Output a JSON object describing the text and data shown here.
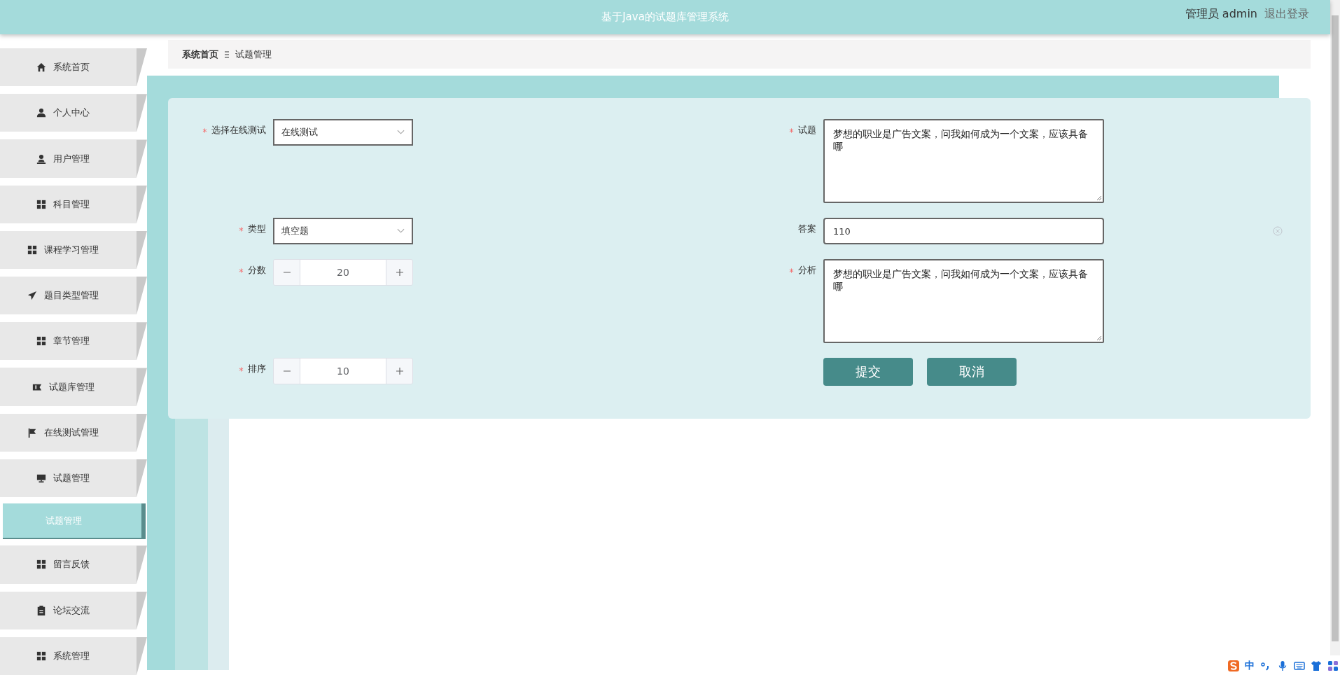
{
  "header": {
    "title": "基于Java的试题库管理系统",
    "user_label": "管理员 admin",
    "logout": "退出登录"
  },
  "sidebar": {
    "items": [
      {
        "label": "系统首页",
        "selected": false
      },
      {
        "label": "个人中心",
        "selected": false
      },
      {
        "label": "用户管理",
        "selected": false
      },
      {
        "label": "科目管理",
        "selected": false
      },
      {
        "label": "课程学习管理",
        "selected": false
      },
      {
        "label": "题目类型管理",
        "selected": false
      },
      {
        "label": "章节管理",
        "selected": false
      },
      {
        "label": "试题库管理",
        "selected": false
      },
      {
        "label": "在线测试管理",
        "selected": false
      },
      {
        "label": "试题管理",
        "selected": false,
        "expanded": true,
        "children": [
          {
            "label": "试题管理",
            "selected": true
          }
        ]
      },
      {
        "label": "留言反馈",
        "selected": false
      },
      {
        "label": "论坛交流",
        "selected": false
      },
      {
        "label": "系统管理",
        "selected": false
      }
    ]
  },
  "breadcrumb": [
    "系统首页",
    "试题管理"
  ],
  "form": {
    "left_fields": [
      {
        "kind": "select",
        "label": "选择在线测试",
        "required": true,
        "value": "在线测试"
      },
      {
        "kind": "select",
        "label": "类型",
        "required": true,
        "value": "填空题"
      },
      {
        "kind": "number",
        "label": "分数",
        "required": true,
        "value": "20"
      },
      {
        "kind": "number",
        "label": "排序",
        "required": true,
        "value": "10"
      }
    ],
    "right_fields": [
      {
        "kind": "textarea",
        "label": "试题",
        "required": true,
        "value": "梦想的职业是广告文案，问我如何成为一个文案，应该具备哪"
      },
      {
        "kind": "text",
        "label": "答案",
        "required": false,
        "value": "110",
        "clearable": true
      },
      {
        "kind": "textarea",
        "label": "分析",
        "required": true,
        "value": "梦想的职业是广告文案，问我如何成为一个文案，应该具备哪"
      }
    ],
    "buttons": [
      "提交",
      "取消"
    ]
  },
  "ime_toolbar": {
    "mode": "中"
  }
}
